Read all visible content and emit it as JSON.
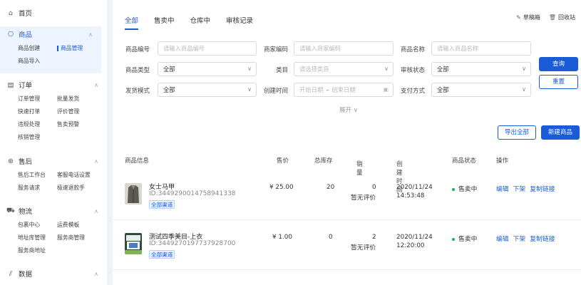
{
  "sidebar": {
    "home": "首页",
    "products": {
      "title": "商品",
      "items": [
        "商品创建",
        "商品管理",
        "商品导入"
      ]
    },
    "orders": {
      "title": "订单",
      "items": [
        "订单管理",
        "批量发货",
        "快速打单",
        "评价管理",
        "违规处理",
        "售卖预警",
        "核销管理"
      ]
    },
    "aftersale": {
      "title": "售后",
      "items": [
        "售后工作台",
        "客服电话设置",
        "服务请求",
        "极速退款手"
      ]
    },
    "logistics": {
      "title": "物流",
      "items": [
        "包裹中心",
        "运费模板",
        "地址库管理",
        "服务商管理",
        "服务商地址"
      ]
    },
    "data": {
      "title": "数据"
    }
  },
  "tabs": [
    "全部",
    "售卖中",
    "仓库中",
    "审核记录"
  ],
  "top_actions": {
    "draft": "草稿箱",
    "recycle": "回收站"
  },
  "filters": {
    "product_code": {
      "label": "商品编号",
      "placeholder": "请输入商品编号"
    },
    "merchant_code": {
      "label": "商家编码",
      "placeholder": "请输入商家编码"
    },
    "product_name": {
      "label": "商品名称",
      "placeholder": "请输入商品名称"
    },
    "product_type": {
      "label": "商品类型",
      "value": "全部"
    },
    "category": {
      "label": "类目",
      "placeholder": "请选择类目"
    },
    "audit_status": {
      "label": "审核状态",
      "value": "全部"
    },
    "ship_mode": {
      "label": "发货模式",
      "value": "全部"
    },
    "created_time": {
      "label": "创建时间",
      "start": "开始日期",
      "sep": "–",
      "end": "结束日期"
    },
    "pay_method": {
      "label": "支付方式",
      "value": "全部"
    },
    "expand": "展开"
  },
  "buttons": {
    "query": "查询",
    "reset": "重置",
    "export_all": "导出全部",
    "new_product": "新建商品"
  },
  "table": {
    "headers": {
      "info": "商品信息",
      "price": "售价",
      "stock": "总库存",
      "sales": "销量",
      "created": "创建时间",
      "status": "商品状态",
      "ops": "操作"
    },
    "rows": [
      {
        "name": "女士马甲",
        "id": "ID:3449290014758941338",
        "tag": "全部渠道",
        "price": "¥ 25.00",
        "stock": "20",
        "sales": "0",
        "rating": "暂无评价",
        "date": "2020/11/24",
        "time": "14:53:48",
        "status": "售卖中",
        "ops": [
          "编辑",
          "下架",
          "复制链接"
        ]
      },
      {
        "name": "测试四季美目-上衣",
        "id": "ID:3449270197737928700",
        "tag": "全部渠道",
        "price": "¥ 1.00",
        "stock": "0",
        "sales": "2",
        "rating": "暂无评价",
        "date": "2020/11/24",
        "time": "12:20:00",
        "status": "售卖中",
        "ops": [
          "编辑",
          "下架",
          "复制链接"
        ]
      }
    ]
  }
}
